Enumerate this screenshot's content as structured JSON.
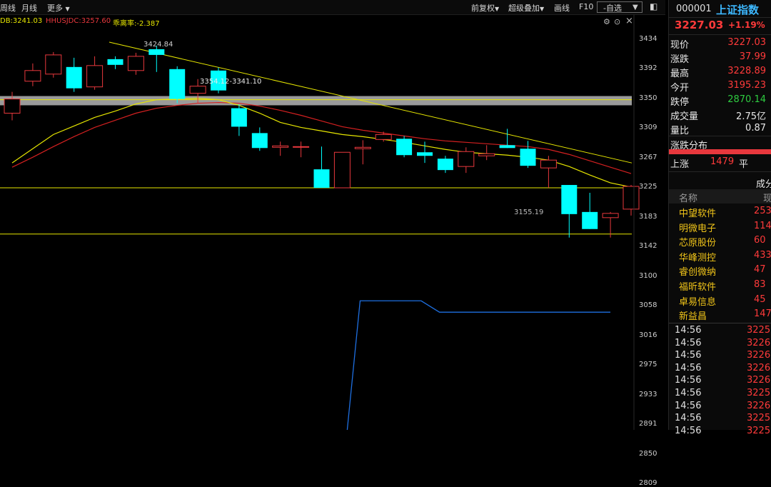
{
  "toolbar": {
    "week_label": "周线",
    "month_label": "月线",
    "more_label": "更多",
    "fq_label": "前复权",
    "overlay_label": "超级叠加",
    "draw_label": "画线",
    "f10_label": "F10",
    "select_label": "-自选"
  },
  "indicators": {
    "sdb": "DB:3241.03",
    "hhusjdc": "HHUSJDC:3257.60",
    "deviation": "乖离率:-2.387"
  },
  "annotations": {
    "high": "3424.84",
    "range": "3354.12-3341.10",
    "low": "3155.19"
  },
  "price_axis": [
    "3434",
    "3392",
    "3350",
    "3309",
    "3267",
    "3225",
    "3183",
    "3142",
    "3100",
    "3058",
    "3016",
    "2975",
    "2933",
    "2891",
    "2850",
    "2809"
  ],
  "stock": {
    "code": "000001",
    "name": "上证指数",
    "price": "3227.03",
    "change_pct": "+1.19%"
  },
  "quote_rows": [
    {
      "label": "现价",
      "value": "3227.03",
      "color": "#ff3a3a"
    },
    {
      "label": "涨跌",
      "value": "37.99",
      "color": "#ff3a3a"
    },
    {
      "label": "最高",
      "value": "3228.89",
      "color": "#ff3a3a"
    },
    {
      "label": "今开",
      "value": "3195.23",
      "color": "#ff3a3a"
    },
    {
      "label": "跌停",
      "value": "2870.14",
      "color": "#2ecc40"
    },
    {
      "label": "成交量",
      "value": "2.75亿",
      "color": "#e8e8e8"
    },
    {
      "label": "量比",
      "value": "0.87",
      "color": "#e8e8e8"
    }
  ],
  "distribution": {
    "title": "涨跌分布",
    "up_label": "上涨",
    "up_count": "1479",
    "flat_label": "平"
  },
  "constituents": {
    "header_partial": "成分",
    "name_header": "名称",
    "value_header_partial": "现",
    "items": [
      {
        "name": "中望软件",
        "value": "253"
      },
      {
        "name": "明微电子",
        "value": "114"
      },
      {
        "name": "芯原股份",
        "value": "60"
      },
      {
        "name": "华峰测控",
        "value": "433"
      },
      {
        "name": "睿创微纳",
        "value": "47"
      },
      {
        "name": "福昕软件",
        "value": "83"
      },
      {
        "name": "卓易信息",
        "value": "45"
      },
      {
        "name": "新益昌",
        "value": "147"
      }
    ]
  },
  "ticks": [
    {
      "time": "14:56",
      "price": "3225."
    },
    {
      "time": "14:56",
      "price": "3226."
    },
    {
      "time": "14:56",
      "price": "3226."
    },
    {
      "time": "14:56",
      "price": "3226."
    },
    {
      "time": "14:56",
      "price": "3226."
    },
    {
      "time": "14:56",
      "price": "3225."
    },
    {
      "time": "14:56",
      "price": "3226."
    },
    {
      "time": "14:56",
      "price": "3225."
    },
    {
      "time": "14:56",
      "price": "3225."
    }
  ],
  "colors": {
    "up": "#e8383d",
    "down": "#00ffff",
    "ma_yellow": "#e6e600",
    "ma_red": "#d42020",
    "line_blue": "#1e6fe0",
    "accent_cyan": "#3db8ff"
  },
  "chart_data": {
    "type": "candlestick",
    "candles": [
      {
        "open": 3330,
        "close": 3350,
        "high": 3360,
        "low": 3320,
        "dir": "up"
      },
      {
        "open": 3375,
        "close": 3390,
        "high": 3400,
        "low": 3368,
        "dir": "up"
      },
      {
        "open": 3385,
        "close": 3412,
        "high": 3416,
        "low": 3380,
        "dir": "up"
      },
      {
        "open": 3395,
        "close": 3365,
        "high": 3408,
        "low": 3360,
        "dir": "down"
      },
      {
        "open": 3367,
        "close": 3397,
        "high": 3410,
        "low": 3363,
        "dir": "up"
      },
      {
        "open": 3398,
        "close": 3406,
        "high": 3410,
        "low": 3392,
        "dir": "down"
      },
      {
        "open": 3390,
        "close": 3410,
        "high": 3415,
        "low": 3384,
        "dir": "up"
      },
      {
        "open": 3420,
        "close": 3412,
        "high": 3425,
        "low": 3388,
        "dir": "down"
      },
      {
        "open": 3392,
        "close": 3350,
        "high": 3396,
        "low": 3344,
        "dir": "down"
      },
      {
        "open": 3358,
        "close": 3368,
        "high": 3378,
        "low": 3344,
        "dir": "up"
      },
      {
        "open": 3390,
        "close": 3362,
        "high": 3394,
        "low": 3358,
        "dir": "down"
      },
      {
        "open": 3337,
        "close": 3311,
        "high": 3342,
        "low": 3298,
        "dir": "down"
      },
      {
        "open": 3302,
        "close": 3281,
        "high": 3310,
        "low": 3277,
        "dir": "down"
      },
      {
        "open": 3282,
        "close": 3284,
        "high": 3290,
        "low": 3270,
        "dir": "up"
      },
      {
        "open": 3282,
        "close": 3283,
        "high": 3290,
        "low": 3268,
        "dir": "up"
      },
      {
        "open": 3251,
        "close": 3225,
        "high": 3283,
        "low": 3225,
        "dir": "down"
      },
      {
        "open": 3225,
        "close": 3275,
        "high": 3275,
        "low": 3225,
        "dir": "up"
      },
      {
        "open": 3280,
        "close": 3282,
        "high": 3292,
        "low": 3258,
        "dir": "up"
      },
      {
        "open": 3293,
        "close": 3300,
        "high": 3304,
        "low": 3290,
        "dir": "up"
      },
      {
        "open": 3294,
        "close": 3271,
        "high": 3298,
        "low": 3268,
        "dir": "down"
      },
      {
        "open": 3275,
        "close": 3270,
        "high": 3290,
        "low": 3260,
        "dir": "down"
      },
      {
        "open": 3266,
        "close": 3250,
        "high": 3270,
        "low": 3246,
        "dir": "down"
      },
      {
        "open": 3255,
        "close": 3276,
        "high": 3282,
        "low": 3246,
        "dir": "up"
      },
      {
        "open": 3270,
        "close": 3273,
        "high": 3285,
        "low": 3264,
        "dir": "up"
      },
      {
        "open": 3285,
        "close": 3281,
        "high": 3308,
        "low": 3281,
        "dir": "down"
      },
      {
        "open": 3280,
        "close": 3256,
        "high": 3291,
        "low": 3253,
        "dir": "down"
      },
      {
        "open": 3253,
        "close": 3264,
        "high": 3270,
        "low": 3225,
        "dir": "up"
      },
      {
        "open": 3229,
        "close": 3188,
        "high": 3229,
        "low": 3155,
        "dir": "down"
      },
      {
        "open": 3191,
        "close": 3167,
        "high": 3218,
        "low": 3167,
        "dir": "down"
      },
      {
        "open": 3183,
        "close": 3189,
        "high": 3191,
        "low": 3155,
        "dir": "up"
      },
      {
        "open": 3195,
        "close": 3227,
        "high": 3229,
        "low": 3186,
        "dir": "up"
      }
    ],
    "ma_yellow": [
      3260,
      3280,
      3300,
      3312,
      3324,
      3333,
      3343,
      3349,
      3350,
      3351,
      3349,
      3341,
      3330,
      3317,
      3310,
      3305,
      3300,
      3297,
      3293,
      3289,
      3284,
      3279,
      3275,
      3273,
      3271,
      3268,
      3264,
      3255,
      3243,
      3232,
      3226
    ],
    "ma_red": [
      3254,
      3268,
      3283,
      3297,
      3310,
      3320,
      3330,
      3337,
      3341,
      3344,
      3345,
      3344,
      3340,
      3334,
      3327,
      3319,
      3311,
      3306,
      3302,
      3298,
      3294,
      3291,
      3289,
      3287,
      3285,
      3283,
      3279,
      3272,
      3263,
      3254,
      3245
    ],
    "trend_line": {
      "from": 3430,
      "to": 3260
    },
    "horizontal_lines": [
      3349,
      3225,
      3160
    ],
    "range_band": [
      3341.1,
      3354.12
    ],
    "blue_line": [
      {
        "x": 0.0,
        "y": 2808
      },
      {
        "x": 0.56,
        "y": 2808
      },
      {
        "x": 0.59,
        "y": 3066
      },
      {
        "x": 0.69,
        "y": 3066
      },
      {
        "x": 0.72,
        "y": 3050
      },
      {
        "x": 1.0,
        "y": 3050
      }
    ],
    "ylim": [
      2809,
      3434
    ]
  }
}
